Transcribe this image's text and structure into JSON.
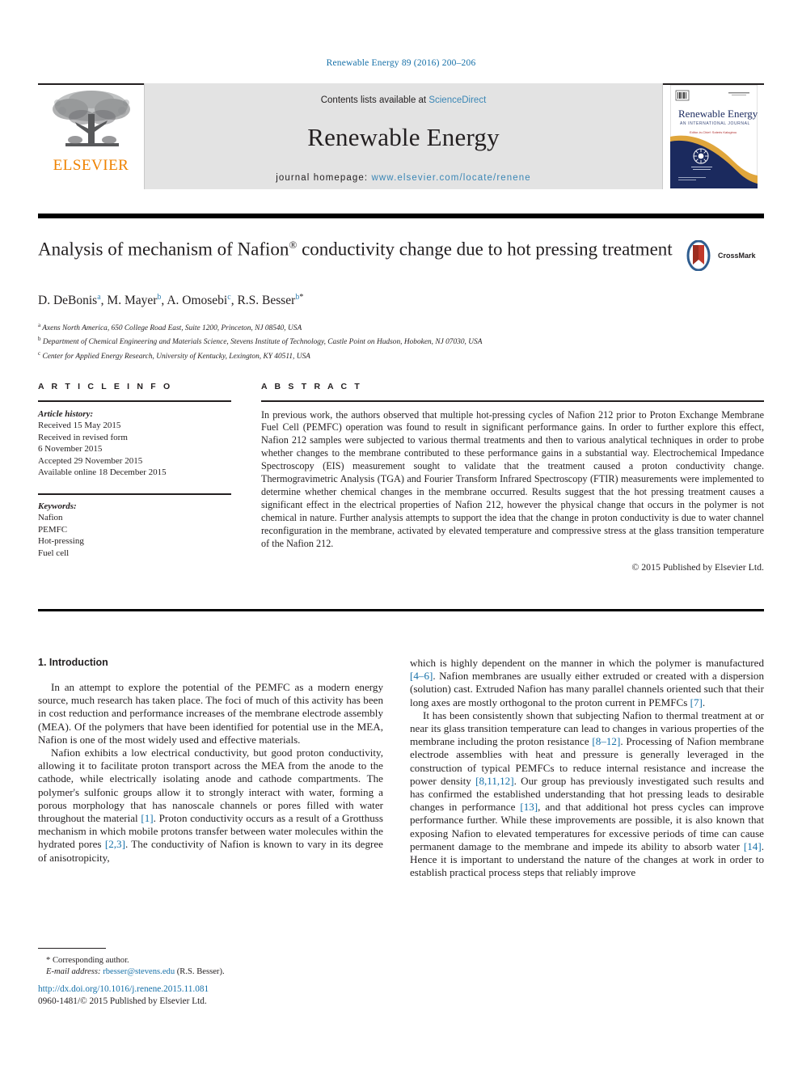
{
  "running_head": "Renewable Energy 89 (2016) 200–206",
  "header": {
    "publisher_logo_text": "ELSEVIER",
    "contents_prefix": "Contents lists available at ",
    "contents_link": "ScienceDirect",
    "journal_title": "Renewable Energy",
    "homepage_prefix": "journal homepage: ",
    "homepage_url": "www.elsevier.com/locate/renene",
    "cover": {
      "title": "Renewable Energy",
      "subtitle": "AN INTERNATIONAL JOURNAL",
      "editor_line": "Editor-in-Chief: Soteris Kalogirou"
    },
    "link_color": "#3a86b5",
    "band_color": "#e3e3e3",
    "elsevier_orange": "#ef8200"
  },
  "article": {
    "title_part1": "Analysis of mechanism of Nafion",
    "title_reg": "®",
    "title_part2": " conductivity change due to hot pressing treatment",
    "crossmark_label": "CrossMark",
    "authors": [
      {
        "name": "D. DeBonis",
        "marks": "a",
        "sep": ", "
      },
      {
        "name": "M. Mayer",
        "marks": "b",
        "sep": ", "
      },
      {
        "name": "A. Omosebi",
        "marks": "c",
        "sep": ", "
      },
      {
        "name": "R.S. Besser",
        "marks": "b",
        "sep": ""
      }
    ],
    "corresponding_star": "*",
    "affiliations": [
      {
        "mark": "a",
        "text": "Axens North America, 650 College Road East, Suite 1200, Princeton, NJ 08540, USA"
      },
      {
        "mark": "b",
        "text": "Department of Chemical Engineering and Materials Science, Stevens Institute of Technology, Castle Point on Hudson, Hoboken, NJ 07030, USA"
      },
      {
        "mark": "c",
        "text": "Center for Applied Energy Research, University of Kentucky, Lexington, KY 40511, USA"
      }
    ]
  },
  "article_info": {
    "heading": "A R T I C L E   I N F O",
    "history_label": "Article history:",
    "history": [
      "Received 15 May 2015",
      "Received in revised form",
      "6 November 2015",
      "Accepted 29 November 2015",
      "Available online 18 December 2015"
    ],
    "keywords_label": "Keywords:",
    "keywords": [
      "Nafion",
      "PEMFC",
      "Hot-pressing",
      "Fuel cell"
    ]
  },
  "abstract": {
    "heading": "A B S T R A C T",
    "text": "In previous work, the authors observed that multiple hot-pressing cycles of Nafion 212 prior to Proton Exchange Membrane Fuel Cell (PEMFC) operation was found to result in significant performance gains. In order to further explore this effect, Nafion 212 samples were subjected to various thermal treatments and then to various analytical techniques in order to probe whether changes to the membrane contributed to these performance gains in a substantial way. Electrochemical Impedance Spectroscopy (EIS) measurement sought to validate that the treatment caused a proton conductivity change. Thermogravimetric Analysis (TGA) and Fourier Transform Infrared Spectroscopy (FTIR) measurements were implemented to determine whether chemical changes in the membrane occurred. Results suggest that the hot pressing treatment causes a significant effect in the electrical properties of Nafion 212, however the physical change that occurs in the polymer is not chemical in nature. Further analysis attempts to support the idea that the change in proton conductivity is due to water channel reconfiguration in the membrane, activated by elevated temperature and compressive stress at the glass transition temperature of the Nafion 212.",
    "copyright": "© 2015 Published by Elsevier Ltd."
  },
  "body": {
    "section_heading": "1.  Introduction",
    "left_paragraphs": [
      "In an attempt to explore the potential of the PEMFC as a modern energy source, much research has taken place. The foci of much of this activity has been in cost reduction and performance increases of the membrane electrode assembly (MEA). Of the polymers that have been identified for potential use in the MEA, Nafion is one of the most widely used and effective materials.",
      "Nafion exhibits a low electrical conductivity, but good proton conductivity, allowing it to facilitate proton transport across the MEA from the anode to the cathode, while electrically isolating anode and cathode compartments. The polymer's sulfonic groups allow it to strongly interact with water, forming a porous morphology that has nanoscale channels or pores filled with water throughout the material [1]. Proton conductivity occurs as a result of a Grotthuss mechanism in which mobile protons transfer between water molecules within the hydrated pores [2,3]. The conductivity of Nafion is known to vary in its degree of anisotropicity,"
    ],
    "right_paragraphs": [
      "which is highly dependent on the manner in which the polymer is manufactured [4–6]. Nafion membranes are usually either extruded or created with a dispersion (solution) cast. Extruded Nafion has many parallel channels oriented such that their long axes are mostly orthogonal to the proton current in PEMFCs [7].",
      "It has been consistently shown that subjecting Nafion to thermal treatment at or near its glass transition temperature can lead to changes in various properties of the membrane including the proton resistance [8–12]. Processing of Nafion membrane electrode assemblies with heat and pressure is generally leveraged in the construction of typical PEMFCs to reduce internal resistance and increase the power density [8,11,12]. Our group has previously investigated such results and has confirmed the established understanding that hot pressing leads to desirable changes in performance [13], and that additional hot press cycles can improve performance further. While these improvements are possible, it is also known that exposing Nafion to elevated temperatures for excessive periods of time can cause permanent damage to the membrane and impede its ability to absorb water [14]. Hence it is important to understand the nature of the changes at work in order to establish practical process steps that reliably improve"
    ]
  },
  "footnote": {
    "star": "*",
    "corresponding": "Corresponding author.",
    "email_label": "E-mail address:",
    "email": "rbesser@stevens.edu",
    "email_owner": "(R.S. Besser)."
  },
  "page_footer": {
    "doi": "http://dx.doi.org/10.1016/j.renene.2015.11.081",
    "issn": "0960-1481/© 2015 Published by Elsevier Ltd."
  }
}
